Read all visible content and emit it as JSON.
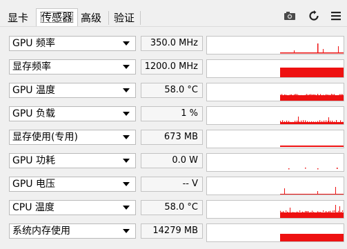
{
  "tabs": [
    {
      "label": "显卡",
      "active": false
    },
    {
      "label": "传感器",
      "active": true
    },
    {
      "label": "高级",
      "active": false
    },
    {
      "label": "验证",
      "active": false
    }
  ],
  "toolbar": {
    "icons": [
      "camera-icon",
      "refresh-icon",
      "menu-icon"
    ]
  },
  "accent_color": "#ee1111",
  "sensors": [
    {
      "name": "GPU 频率",
      "value": "350.0 MHz",
      "graph": "spiky-low"
    },
    {
      "name": "显存频率",
      "value": "1200.0 MHz",
      "graph": "block-high"
    },
    {
      "name": "GPU 温度",
      "value": "58.0 °C",
      "graph": "noisy-mid"
    },
    {
      "name": "GPU 负载",
      "value": "1 %",
      "graph": "noisy-low"
    },
    {
      "name": "显存使用(专用)",
      "value": "673 MB",
      "graph": "flat-low"
    },
    {
      "name": "GPU 功耗",
      "value": "0.0 W",
      "graph": "dots"
    },
    {
      "name": "GPU 电压",
      "value": "-- V",
      "graph": "sparse-spikes"
    },
    {
      "name": "CPU 温度",
      "value": "58.0 °C",
      "graph": "noisy-mid-spikes"
    },
    {
      "name": "系统内存使用",
      "value": "14279 MB",
      "graph": "block-mid"
    }
  ]
}
